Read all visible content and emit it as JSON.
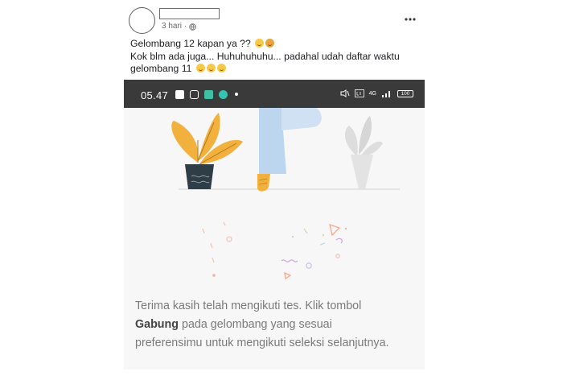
{
  "post": {
    "time": "3 hari ·",
    "caption_line1": "Gelombang 12 kapan ya ??",
    "caption_line2": "Kok blm ada juga... Huhuhuhuhu... padahal udah daftar waktu",
    "caption_line3": "gelombang 11"
  },
  "phone": {
    "time": "05.47",
    "signal_label": "4G",
    "battery": "100"
  },
  "message": {
    "part1": "Terima kasih telah mengikuti tes. Klik tombol",
    "bold": "Gabung",
    "part2": " pada gelombang yang sesuai",
    "part3": "preferensimu untuk mengikuti seleksi selanjutnya."
  },
  "icons": {
    "more": "more-horizontal-icon",
    "globe": "globe-icon"
  },
  "colors": {
    "accent_orange": "#f2b03c",
    "statusbar": "#3a3a3a",
    "text_gray": "#7a7a7a"
  }
}
